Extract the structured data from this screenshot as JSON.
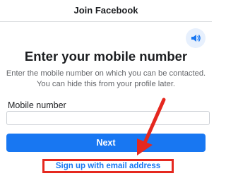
{
  "header": {
    "title": "Join Facebook"
  },
  "audio_button": {
    "icon": "speaker-icon"
  },
  "main": {
    "heading": "Enter your mobile number",
    "description": "Enter the mobile number on which you can be contacted. You can hide this from your profile later.",
    "mobile_field": {
      "label": "Mobile number",
      "value": "",
      "placeholder": ""
    },
    "next_label": "Next",
    "email_link": "Sign up with email address"
  },
  "annotation": {
    "arrow_icon": "red-arrow-icon",
    "highlight_color": "#e5281f"
  },
  "colors": {
    "accent": "#1877f2",
    "text": "#1c1e21",
    "muted": "#65676b"
  }
}
